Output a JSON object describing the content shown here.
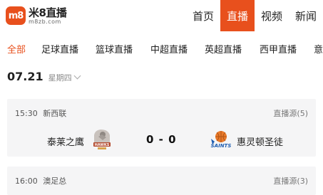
{
  "header": {
    "logo_badge": "m8",
    "logo_name": "米8直播",
    "logo_sub": "m8zb.com",
    "nav": [
      {
        "label": "首页",
        "active": false
      },
      {
        "label": "直播",
        "active": true
      },
      {
        "label": "视频",
        "active": false
      },
      {
        "label": "新闻",
        "active": false
      }
    ]
  },
  "tabs": [
    {
      "label": "全部",
      "active": true
    },
    {
      "label": "足球直播",
      "active": false
    },
    {
      "label": "篮球直播",
      "active": false
    },
    {
      "label": "中超直播",
      "active": false
    },
    {
      "label": "英超直播",
      "active": false
    },
    {
      "label": "西甲直播",
      "active": false
    },
    {
      "label": "意",
      "active": false
    }
  ],
  "date_row": {
    "date": "07.21",
    "weekday": "星期四"
  },
  "matches": [
    {
      "time": "15:30",
      "league": "新西联",
      "source": "直播源(5)",
      "home": "泰莱之鹰",
      "score": "0 - 0",
      "away": "惠灵顿圣徒",
      "away_logo_text": "SAINTS",
      "home_logo_text": "HAWKS"
    },
    {
      "time": "16:00",
      "league": "澳足总",
      "source": "直播源(3)"
    }
  ],
  "colors": {
    "accent": "#e8501d",
    "card_bg": "#f5f5f6"
  }
}
